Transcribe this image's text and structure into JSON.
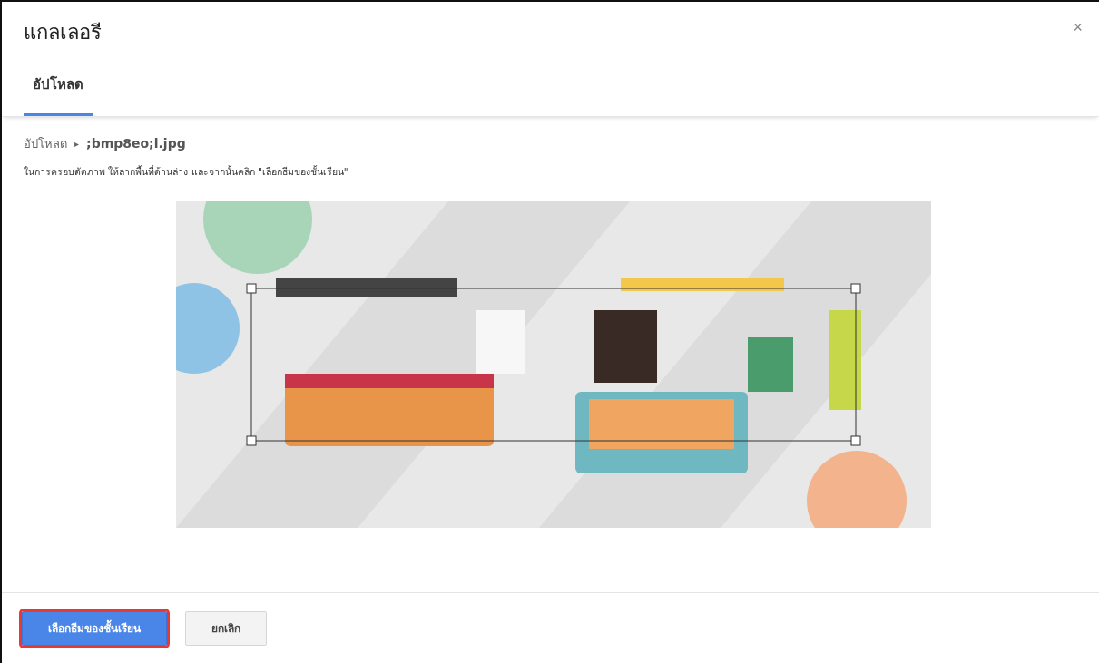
{
  "window": {
    "title": "แกลเลอรี",
    "close": "×"
  },
  "tabs": [
    {
      "label": "อัปโหลด",
      "selected": true
    }
  ],
  "breadcrumb": {
    "parent": "อัปโหลด",
    "separator": "▸",
    "file": ";bmp8eo;l.jpg"
  },
  "instruction": "ในการครอบตัดภาพ ให้ลากพื้นที่ด้านล่าง และจากนั้นคลิก \"เลือกธีมของชั้นเรียน\"",
  "buttons": [
    {
      "label": "เลือกธีมของชั้นเรียน",
      "kind": "primary",
      "highlighted": true
    },
    {
      "label": "ยกเลิก",
      "kind": "secondary",
      "highlighted": false
    }
  ]
}
